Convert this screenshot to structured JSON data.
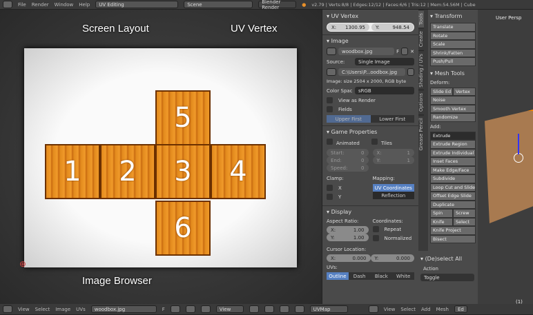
{
  "topbar": {
    "menus": [
      "File",
      "Render",
      "Window",
      "Help"
    ],
    "screen_layout": "UV Editing",
    "scene": "Scene",
    "engine": "Blender Render",
    "stats": "v2.79 | Verts:8/8 | Edges:12/12 | Faces:6/6 | Tris:12 | Mem:54.56M | Cube"
  },
  "annotations": {
    "screen_layout": "Screen Layout",
    "uv_vertex": "UV Vertex",
    "image_browser": "Image Browser"
  },
  "uv_faces": [
    "1",
    "2",
    "3",
    "4",
    "5",
    "6"
  ],
  "npanel": {
    "uv_vertex": {
      "title": "UV Vertex",
      "x_label": "X:",
      "x": "1300.95",
      "y_label": "Y:",
      "y": "948.54"
    },
    "image": {
      "title": "Image",
      "name": "woodbox.jpg",
      "f": "F",
      "source_label": "Source:",
      "source": "Single Image",
      "path": "C:\\Users\\P...oodbox.jpg",
      "info": "Image: size 2504 x 2000, RGB byte",
      "color_space_label": "Color Spac",
      "color_space": "sRGB",
      "view_as_render": "View as Render",
      "fields": "Fields",
      "upper_first": "Upper First",
      "lower_first": "Lower First"
    },
    "game": {
      "title": "Game Properties",
      "animated": "Animated",
      "tiles": "Tiles",
      "start": "Start:",
      "start_v": "0",
      "end": "End:",
      "end_v": "0",
      "speed": "Speed:",
      "speed_v": "0",
      "tx": "X:",
      "tx_v": "1",
      "ty": "Y:",
      "ty_v": "1",
      "clamp": "Clamp:",
      "cx": "X",
      "cy": "Y",
      "mapping": "Mapping:",
      "uv_coords": "UV Coordinates",
      "reflection": "Reflection"
    },
    "display": {
      "title": "Display",
      "aspect": "Aspect Ratio:",
      "ax": "X:",
      "ax_v": "1.00",
      "ay": "Y:",
      "ay_v": "1.00",
      "coordinates": "Coordinates:",
      "repeat": "Repeat",
      "normalized": "Normalized",
      "cursor": "Cursor Location:",
      "cx": "X:",
      "cx_v": "0.000",
      "cy": "Y:",
      "cy_v": "0.000",
      "uvs": "UVs:",
      "outline": "Outline",
      "dash": "Dash",
      "black": "Black",
      "white": "White"
    }
  },
  "tabs": [
    "Tools",
    "Create",
    "Shading / UVs",
    "Options",
    "Grease Pencil"
  ],
  "tools": {
    "transform": "Transform",
    "transform_items": [
      "Translate",
      "Rotate",
      "Scale",
      "Shrink/Fatten",
      "Push/Pull"
    ],
    "mesh_tools": "Mesh Tools",
    "deform": "Deform:",
    "slide_edge": "Slide Ed",
    "vertex": "Vertex",
    "deform_items": [
      "Noise",
      "Smooth Vertex",
      "Randomize"
    ],
    "add": "Add:",
    "extrude": "Extrude",
    "add_items": [
      "Extrude Region",
      "Extrude Individual",
      "Inset Faces",
      "Make Edge/Face",
      "Subdivide",
      "Loop Cut and Slide",
      "Offset Edge Slide",
      "Duplicate"
    ],
    "spin": "Spin",
    "screw": "Screw",
    "knife": "Knife",
    "select": "Select",
    "knife_project": "Knife Project",
    "bisect": "Bisect"
  },
  "redo": {
    "title": "(De)select All",
    "action": "Action",
    "toggle": "Toggle"
  },
  "viewport": {
    "label": "User Persp",
    "object": "(1) Cub",
    "menus": [
      "View",
      "Select",
      "Add",
      "Mesh"
    ],
    "mode": "Ed"
  },
  "bottom": {
    "menus": [
      "View",
      "Select",
      "Image",
      "UVs"
    ],
    "image": "woodbox.jpg",
    "f": "F",
    "view": "View",
    "uvmap": "UVMap"
  }
}
